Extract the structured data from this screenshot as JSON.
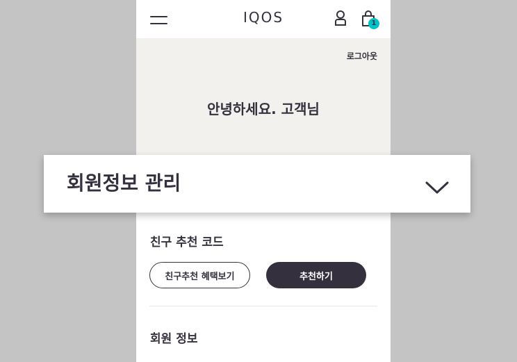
{
  "header": {
    "logo_text": "IQOS",
    "menu_icon": "hamburger-menu-icon",
    "user_icon": "user-icon",
    "cart_icon": "shopping-bag-icon",
    "cart_count": "1"
  },
  "greeting_section": {
    "logout_label": "로그아웃",
    "greeting_text": "안녕하세요. 고객님"
  },
  "accordion": {
    "title": "회원정보 관리",
    "icon": "chevron-down-icon",
    "expanded": false
  },
  "referral": {
    "title": "친구 추천 코드",
    "benefit_button": "친구추천 혜택보기",
    "recommend_button": "추천하기"
  },
  "member_info": {
    "title": "회원 정보"
  },
  "colors": {
    "page_bg": "#c4c4c4",
    "greeting_bg": "#f3f1ee",
    "dark": "#34303d",
    "badge": "#00c2c7"
  }
}
